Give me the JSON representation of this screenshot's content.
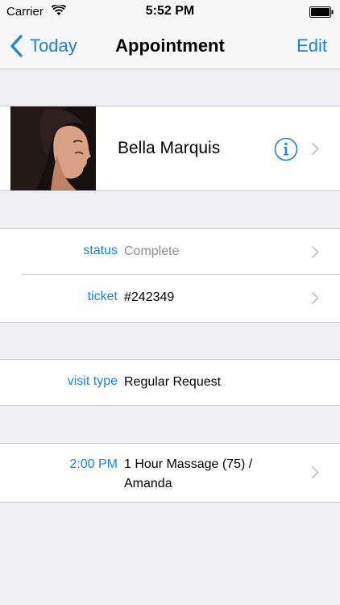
{
  "statusbar": {
    "carrier": "Carrier",
    "time": "5:52 PM"
  },
  "navbar": {
    "back_label": "Today",
    "title": "Appointment",
    "edit_label": "Edit"
  },
  "contact": {
    "name": "Bella Marquis"
  },
  "details": {
    "status": {
      "label": "status",
      "value": "Complete"
    },
    "ticket": {
      "label": "ticket",
      "value": "#242349"
    }
  },
  "visit": {
    "label": "visit type",
    "value": "Regular Request"
  },
  "service": {
    "time": "2:00 PM",
    "line1": "1 Hour Massage (75) /",
    "line2": "Amanda"
  },
  "colors": {
    "accent": "#1a82e0",
    "background": "#efeff4",
    "separator": "#c8c7cc",
    "muted": "#8e8e93"
  },
  "icons": [
    "wifi-icon",
    "battery-icon",
    "back-chevron-icon",
    "info-icon",
    "chevron-right-icon"
  ]
}
